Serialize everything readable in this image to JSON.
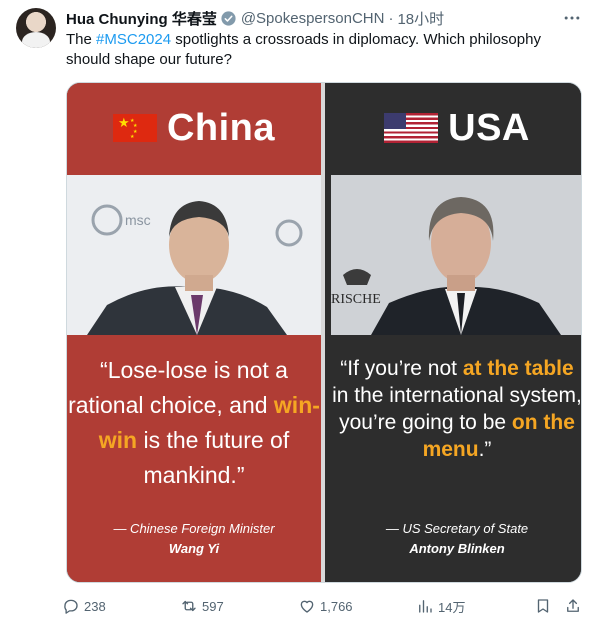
{
  "tweet": {
    "display_name": "Hua Chunying 华春莹",
    "handle": "@SpokespersonCHN",
    "separator": "·",
    "time": "18小时",
    "text_before": "The ",
    "hashtag": "#MSC2024",
    "text_after": " spotlights a crossroads in diplomacy. Which philosophy should shape our future?"
  },
  "media": {
    "left": {
      "country": "China",
      "quote_parts": [
        "“Lose-lose is not a rational choice, and ",
        "win-win",
        " is the future of mankind.”"
      ],
      "attribution_title": "— Chinese Foreign Minister",
      "attribution_name": "Wang Yi",
      "backdrop_text": "msc"
    },
    "right": {
      "country": "USA",
      "quote_parts": [
        "“If you’re not ",
        "at the table",
        " in the international system, you’re going to be ",
        "on the menu",
        ".”"
      ],
      "attribution_title": "— US Secretary of State",
      "attribution_name": "Antony Blinken",
      "backdrop_text": "RISCHE"
    }
  },
  "actions": {
    "replies": "238",
    "reposts": "597",
    "likes": "1,766",
    "views": "14万"
  },
  "colors": {
    "china_red": "#b03d35",
    "usa_dark": "#2d2d2d",
    "highlight": "#f5a623",
    "link_blue": "#1d9bf0",
    "muted": "#536471"
  },
  "icons": [
    "verified-icon",
    "more-icon",
    "reply-icon",
    "repost-icon",
    "like-icon",
    "views-icon",
    "bookmark-icon",
    "share-icon"
  ]
}
